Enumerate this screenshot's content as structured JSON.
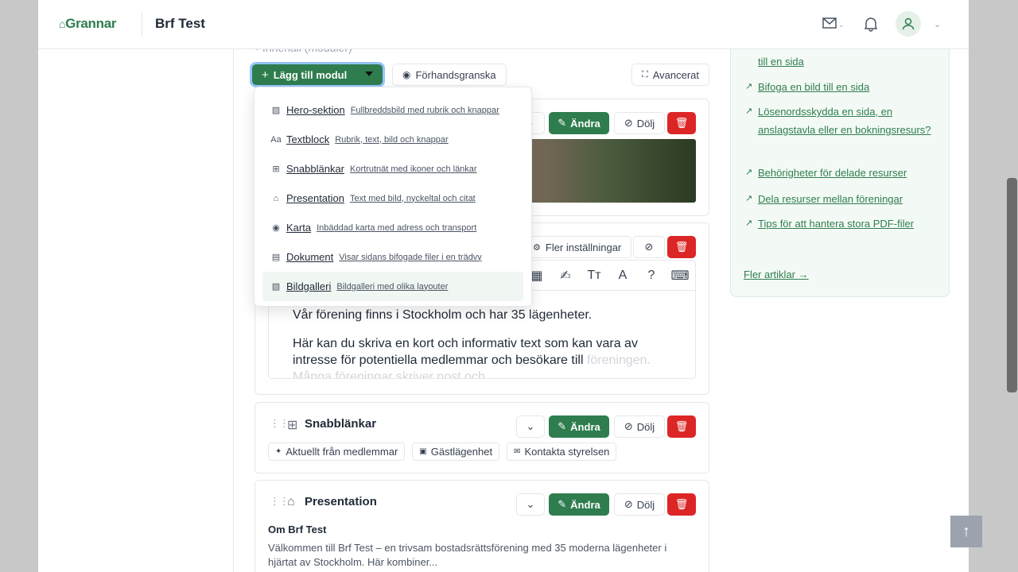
{
  "header": {
    "logo": "Grannar",
    "org_name": "Brf Test"
  },
  "editor": {
    "section_label": "Innehåll (moduler)",
    "add_module_label": "Lägg till modul",
    "preview_label": "Förhandsgranska",
    "advanced_label": "Avancerat"
  },
  "module_menu": [
    {
      "icon": "image-icon",
      "label": "Hero-sektion",
      "desc": "Fullbreddsbild med rubrik och knappar"
    },
    {
      "icon": "text-icon",
      "label": "Textblock",
      "desc": "Rubrik, text, bild och knappar"
    },
    {
      "icon": "grid-icon",
      "label": "Snabblänkar",
      "desc": "Kortrutnät med ikoner och länkar"
    },
    {
      "icon": "building-icon",
      "label": "Presentation",
      "desc": "Text med bild, nyckeltal och citat"
    },
    {
      "icon": "map-pin-icon",
      "label": "Karta",
      "desc": "Inbäddad karta med adress och transport"
    },
    {
      "icon": "document-icon",
      "label": "Dokument",
      "desc": "Visar sidans bifogade filer i en trädvy"
    },
    {
      "icon": "gallery-icon",
      "label": "Bildgalleri",
      "desc": "Bildgalleri med olika layouter"
    }
  ],
  "modules": {
    "actions": {
      "edit": "Ändra",
      "hide": "Dölj"
    },
    "text_block": {
      "more_settings": "Fler inställningar",
      "para1": "Vår förening finns i Stockholm och har 35 lägenheter.",
      "para2": "Här kan du skriva en kort och informativ text som kan vara av intresse för potentiella medlemmar och besökare till",
      "para3": "föreningen. Många föreningar skriver nost och"
    },
    "quicklinks": {
      "title": "Snabblänkar",
      "chips": [
        "Aktuellt från medlemmar",
        "Gästlägenhet",
        "Kontakta styrelsen"
      ]
    },
    "presentation": {
      "title": "Presentation",
      "subtitle": "Om Brf Test",
      "text": "Välkommen till Brf Test – en trivsam bostadsrättsförening med 35 moderna lägenheter i hjärtat av Stockholm. Här kombiner..."
    }
  },
  "help_articles": {
    "partial_top": "till en sida",
    "items": [
      "Bifoga en bild till en sida",
      "Lösenordsskydda en sida, en anslagstavla eller en bokningsresurs?",
      "Behörigheter för delade resurser",
      "Dela resurser mellan föreningar",
      "Tips för att hantera stora PDF-filer"
    ],
    "more": "Fler artiklar →"
  },
  "colors": {
    "brand": "#2f7d4f",
    "danger": "#dc2626"
  }
}
